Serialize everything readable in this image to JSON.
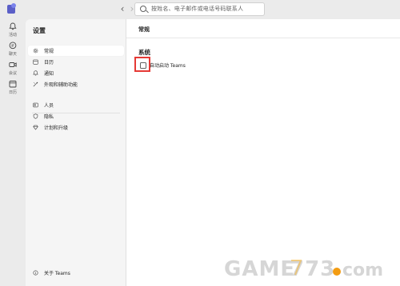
{
  "titlebar": {
    "search_placeholder": "按姓名、电子邮件或电话号码联系人"
  },
  "rail": {
    "items": [
      {
        "label": "活动",
        "icon": "bell-icon"
      },
      {
        "label": "聊天",
        "icon": "chat-icon"
      },
      {
        "label": "会议",
        "icon": "video-icon"
      },
      {
        "label": "日历",
        "icon": "calendar-icon"
      }
    ]
  },
  "settings": {
    "title": "设置",
    "menu": [
      {
        "label": "常规",
        "icon": "gear-icon",
        "selected": true
      },
      {
        "label": "日历",
        "icon": "calendar-icon"
      },
      {
        "label": "通知",
        "icon": "bell-icon"
      },
      {
        "label": "外观和辅助功能",
        "icon": "brush-icon"
      },
      {
        "label": "人员",
        "icon": "people-icon"
      },
      {
        "label": "隐私",
        "icon": "shield-icon"
      },
      {
        "label": "计划和升级",
        "icon": "diamond-icon"
      }
    ],
    "about": "关于 Teams"
  },
  "content": {
    "title": "常规",
    "section": "系统",
    "autostart_label": "自动启动 Teams",
    "autostart_checked": false
  },
  "watermark": {
    "text": "GAME773.com"
  },
  "colors": {
    "accent": "#5b5fc7",
    "highlight": "#e53935",
    "rail_bg": "#ebebeb",
    "panel_bg": "#f5f5f5"
  }
}
